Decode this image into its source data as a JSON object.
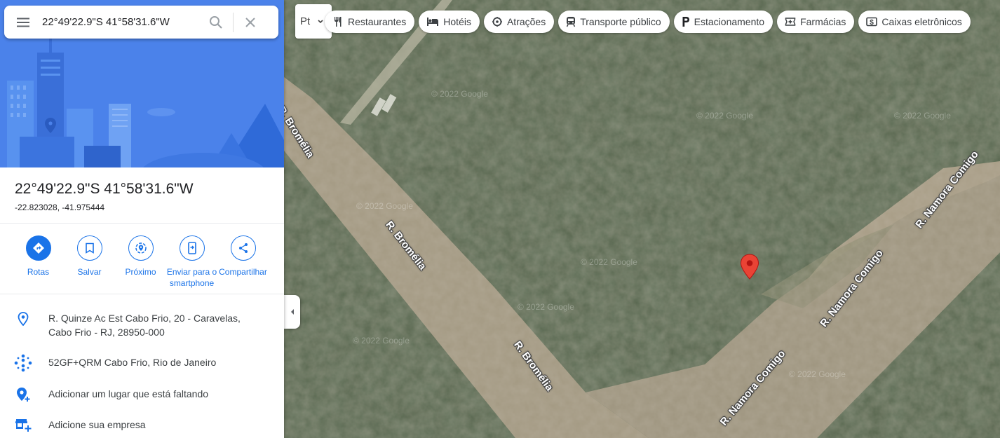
{
  "search": {
    "value": "22°49'22.9\"S 41°58'31.6\"W"
  },
  "place": {
    "title": "22°49'22.9\"S 41°58'31.6\"W",
    "coords": "-22.823028, -41.975444"
  },
  "actions": [
    {
      "label": "Rotas",
      "icon": "directions-icon"
    },
    {
      "label": "Salvar",
      "icon": "bookmark-icon"
    },
    {
      "label": "Próximo",
      "icon": "nearby-icon"
    },
    {
      "label": "Enviar para o smartphone",
      "icon": "send-to-phone-icon"
    },
    {
      "label": "Compartilhar",
      "icon": "share-icon"
    }
  ],
  "info": [
    {
      "text": "R. Quinze Ac Est Cabo Frio, 20 - Caravelas, Cabo Frio - RJ, 28950-000",
      "icon": "location-pin-icon"
    },
    {
      "text": "52GF+QRM Cabo Frio, Rio de Janeiro",
      "icon": "plus-code-icon"
    },
    {
      "text": "Adicionar um lugar que está faltando",
      "icon": "add-place-icon"
    },
    {
      "text": "Adicione sua empresa",
      "icon": "add-business-icon"
    }
  ],
  "layer_button": {
    "label": "Pt"
  },
  "chips": [
    {
      "label": "Restaurantes",
      "icon": "restaurant-icon"
    },
    {
      "label": "Hotéis",
      "icon": "hotel-icon"
    },
    {
      "label": "Atrações",
      "icon": "attractions-icon"
    },
    {
      "label": "Transporte público",
      "icon": "transit-icon"
    },
    {
      "label": "Estacionamento",
      "icon": "parking-icon"
    },
    {
      "label": "Farmácias",
      "icon": "pharmacy-icon"
    },
    {
      "label": "Caixas eletrônicos",
      "icon": "atm-icon"
    }
  ],
  "map": {
    "roads": [
      "R. Bromélia",
      "R. Bromélia",
      "R. Bromélia",
      "R. Namora Comigo",
      "R. Namora Comigo",
      "R. Namora Comigo"
    ],
    "watermark": "© 2022 Google"
  },
  "colors": {
    "accent": "#1a73e8",
    "pin": "#ea4335",
    "vegetation": "#4c5b45",
    "road": "#a59a83"
  }
}
